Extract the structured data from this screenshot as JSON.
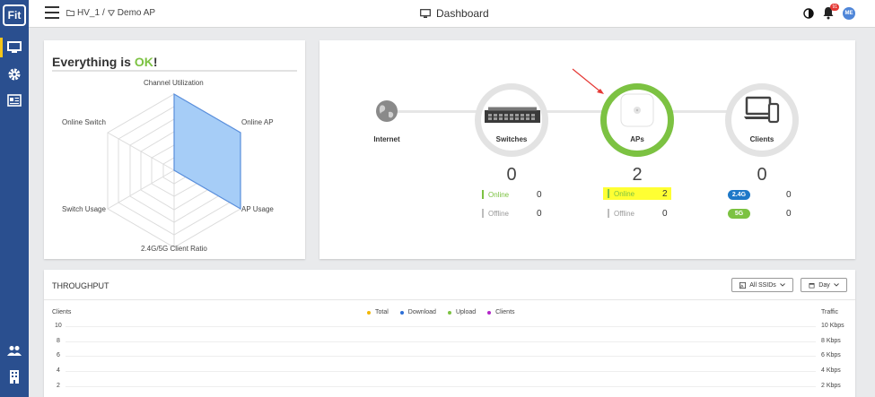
{
  "brand": {
    "logo_text": "Fit"
  },
  "colors": {
    "rail": "#2a4f8f",
    "accent_green": "#7cc242",
    "highlight": "#ffff33",
    "pill_blue": "#1e78c8",
    "pill_green": "#7cc242"
  },
  "sidebar": {
    "items": [
      {
        "icon": "monitor-icon",
        "active": true
      },
      {
        "icon": "gear-icon"
      },
      {
        "icon": "report-icon"
      },
      {
        "icon": "users-icon"
      },
      {
        "icon": "building-icon"
      }
    ]
  },
  "header": {
    "breadcrumb": [
      "HV_1",
      "Demo AP"
    ],
    "breadcrumb_sep": "/",
    "title": "Dashboard",
    "notifications_badge": "91",
    "avatar_initials": "ME"
  },
  "status_card": {
    "title_prefix": "Everything is ",
    "title_status": "OK",
    "title_suffix": "!",
    "radar_labels": {
      "top": "Channel Utilization",
      "top_right": "Online AP",
      "bottom_right": "AP Usage",
      "bottom": "2.4G/5G Client Ratio",
      "bottom_left": "Switch Usage",
      "top_left": "Online Switch"
    }
  },
  "topology": {
    "internet_label": "Internet",
    "switches": {
      "label": "Switches",
      "count": "0",
      "online_label": "Online",
      "online": "0",
      "offline_label": "Offline",
      "offline": "0"
    },
    "aps": {
      "label": "APs",
      "count": "2",
      "online_label": "Online",
      "online": "2",
      "offline_label": "Offline",
      "offline": "0"
    },
    "clients": {
      "label": "Clients",
      "count": "0",
      "band1_label": "2.4G",
      "band1": "0",
      "band2_label": "5G",
      "band2": "0"
    }
  },
  "throughput": {
    "title": "THROUGHPUT",
    "ssid_button": "All SSIDs",
    "period_button": "Day",
    "left_axis_title": "Clients",
    "right_axis_title": "Traffic",
    "legend": [
      {
        "label": "Total",
        "color": "#f2b705"
      },
      {
        "label": "Download",
        "color": "#2d6fd6"
      },
      {
        "label": "Upload",
        "color": "#7cc242"
      },
      {
        "label": "Clients",
        "color": "#b325c8"
      }
    ],
    "left_ticks": [
      "10",
      "8",
      "6",
      "4",
      "2"
    ],
    "right_ticks": [
      "10 Kbps",
      "8 Kbps",
      "6 Kbps",
      "4 Kbps",
      "2 Kbps"
    ]
  }
}
